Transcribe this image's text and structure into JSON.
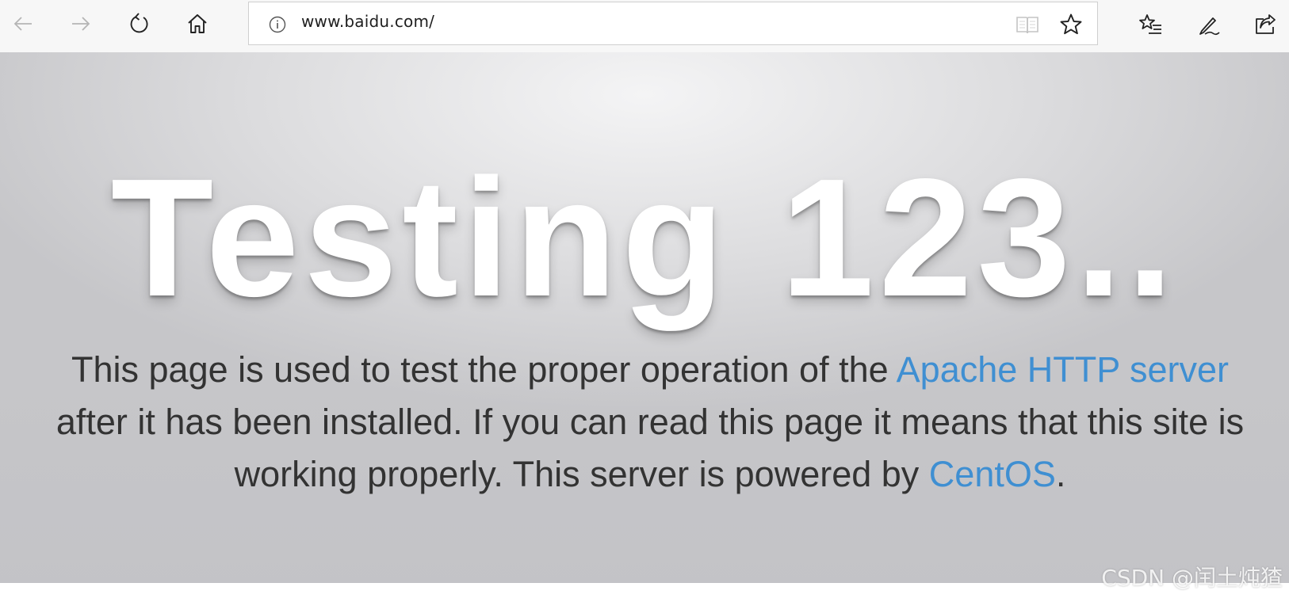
{
  "browser": {
    "address_bar": {
      "url": "www.baidu.com/"
    },
    "icons": {
      "back": "back-arrow-icon",
      "forward": "forward-arrow-icon",
      "refresh": "refresh-icon",
      "home": "home-icon",
      "info": "info-icon",
      "reading_view": "reading-view-icon",
      "favorite": "star-icon",
      "favorites_hub": "favorites-list-icon",
      "notes": "pen-icon",
      "share": "share-icon"
    }
  },
  "page": {
    "headline": "Testing 123..",
    "lead": {
      "part1": "This page is used to test the proper operation of the ",
      "link1": "Apache HTTP server",
      "part2": " after it has been installed. If you can read this page it means that this site is working properly. This server is powered by ",
      "link2": "CentOS",
      "part3": "."
    }
  },
  "watermark": "CSDN @闰土炖猹",
  "colors": {
    "link": "#3f8fd2",
    "text": "#333333",
    "headline": "#ffffff"
  }
}
